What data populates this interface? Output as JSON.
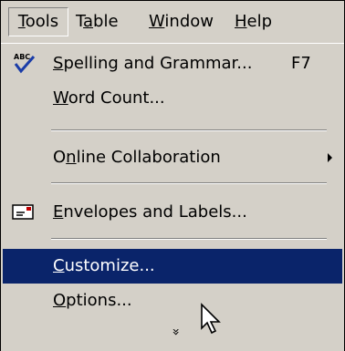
{
  "menubar": {
    "items": [
      {
        "pre": "",
        "u": "T",
        "post": "ools"
      },
      {
        "pre": "T",
        "u": "a",
        "post": "ble"
      },
      {
        "pre": "",
        "u": "W",
        "post": "indow"
      },
      {
        "pre": "",
        "u": "H",
        "post": "elp"
      }
    ]
  },
  "menu": {
    "spelling": {
      "pre": "",
      "u": "S",
      "post": "pelling and Grammar...",
      "shortcut": "F7",
      "icon_text": "ABC"
    },
    "word_count": {
      "pre": "",
      "u": "W",
      "post": "ord Count..."
    },
    "online_collab": {
      "pre": "O",
      "u": "n",
      "post": "line Collaboration"
    },
    "envelopes": {
      "pre": "",
      "u": "E",
      "post": "nvelopes and Labels..."
    },
    "customize": {
      "pre": "",
      "u": "C",
      "post": "ustomize..."
    },
    "options": {
      "pre": "",
      "u": "O",
      "post": "ptions..."
    },
    "expand_glyph": "»"
  },
  "colors": {
    "menu_bg": "#d4d0c8",
    "highlight": "#0a246a",
    "highlight_text": "#ffffff"
  }
}
